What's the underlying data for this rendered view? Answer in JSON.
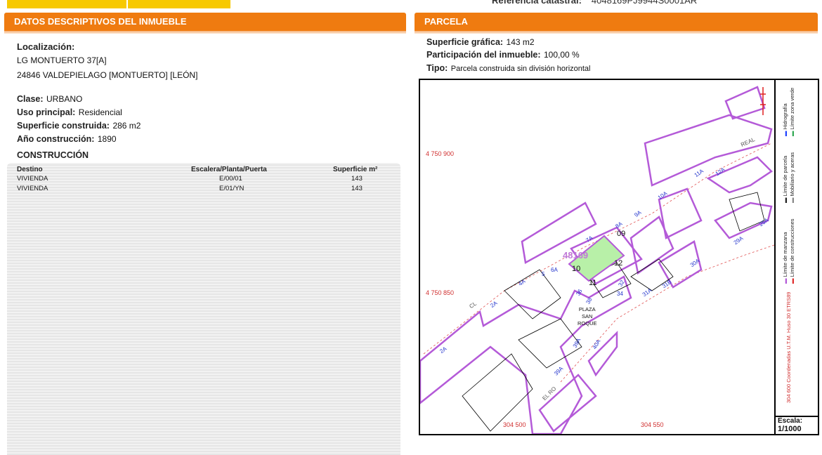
{
  "top": {
    "ref_label": "Referencia catastral:",
    "ref_value": "4048169PJ9944S0001AR"
  },
  "left": {
    "header": "DATOS DESCRIPTIVOS DEL INMUEBLE",
    "localizacion_label": "Localización:",
    "address_line1": "LG MONTUERTO 37[A]",
    "address_line2": "24846 VALDEPIELAGO [MONTUERTO] [LEÓN]",
    "clase_label": "Clase:",
    "clase_value": "URBANO",
    "uso_label": "Uso principal:",
    "uso_value": "Residencial",
    "superficie_label": "Superficie construida:",
    "superficie_value": "286 m2",
    "anio_label": "Año construcción:",
    "anio_value": "1890",
    "construccion_title": "CONSTRUCCIÓN",
    "table": {
      "headers": [
        "Destino",
        "Escalera/Planta/Puerta",
        "Superficie m²"
      ],
      "rows": [
        [
          "VIVIENDA",
          "E/00/01",
          "143"
        ],
        [
          "VIVIENDA",
          "E/01/YN",
          "143"
        ]
      ]
    }
  },
  "right": {
    "header": "PARCELA",
    "sup_grafica_label": "Superficie gráfica:",
    "sup_grafica_value": "143 m2",
    "participacion_label": "Participación del inmueble:",
    "participacion_value": "100,00 %",
    "tipo_label": "Tipo:",
    "tipo_value": "Parcela construida sin división horizontal"
  },
  "map": {
    "parcel_id": "48169",
    "y_coord_top": "4 750 900",
    "y_coord_bottom": "4 750 850",
    "x_coord_left": "304 500",
    "x_coord_right": "304 550",
    "plaza_line1": "PLAZA",
    "plaza_line2": "SAN",
    "plaza_line3": "ROQUE",
    "subparcels": [
      "09",
      "10",
      "11",
      "12"
    ],
    "street_labels": [
      "2A",
      "2A",
      "4A",
      "5",
      "6A",
      "7A",
      "8A",
      "9A",
      "10A",
      "11A",
      "12A",
      "26A",
      "29A",
      "30A",
      "31B",
      "31A",
      "32",
      "34",
      "36",
      "38",
      "39A",
      "40A",
      "39A",
      "CL",
      "EL RO",
      "REAL"
    ],
    "coord_system": "304 600 Coordenadas U.T.M. Huso 30 ETRS89",
    "legend": [
      "Límite de manzana",
      "Límite de construcciones",
      "Límite de parcela",
      "Mobiliario y aceras",
      "Hidrografía",
      "Límite zona verde"
    ],
    "legend_colors": [
      "#b45ad8",
      "#e03030",
      "#000000",
      "#888888",
      "#2244ff",
      "#33aa55"
    ],
    "scale_label": "Escala:",
    "scale_value": "1/1000"
  }
}
